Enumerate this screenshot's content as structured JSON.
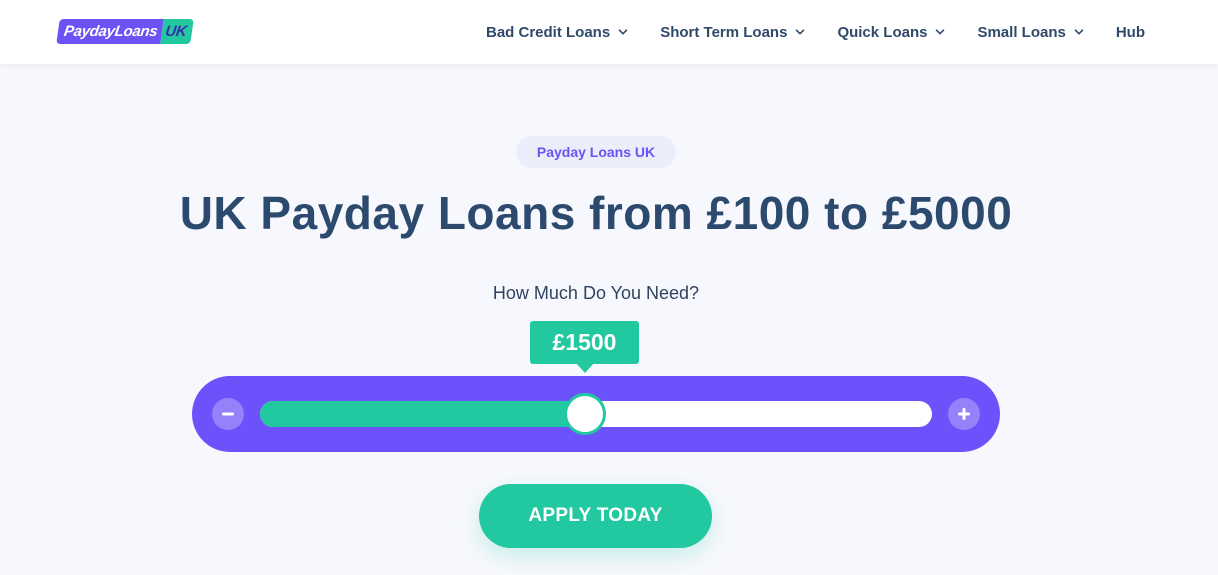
{
  "colors": {
    "brand_purple": "#6b52fa",
    "brand_green": "#22c8a0",
    "heading": "#2c4a6e",
    "background": "#f7f8fd"
  },
  "logo": {
    "main_text": "PaydayLoans",
    "uk_text": "UK"
  },
  "nav": {
    "items": [
      {
        "label": "Bad Credit Loans",
        "icon": "chevron-down-icon"
      },
      {
        "label": "Short Term Loans",
        "icon": "chevron-down-icon"
      },
      {
        "label": "Quick Loans",
        "icon": "chevron-down-icon"
      },
      {
        "label": "Small Loans",
        "icon": "chevron-down-icon"
      },
      {
        "label": "Hub"
      }
    ]
  },
  "hero": {
    "badge": "Payday Loans UK",
    "title": "UK Payday Loans from £100 to £5000",
    "question": "How Much Do You Need?"
  },
  "slider": {
    "value_label": "£1500",
    "value": 1500,
    "fill_fraction": 0.484,
    "minus_icon": "minus-icon",
    "plus_icon": "plus-icon"
  },
  "cta": {
    "label": "APPLY TODAY"
  }
}
